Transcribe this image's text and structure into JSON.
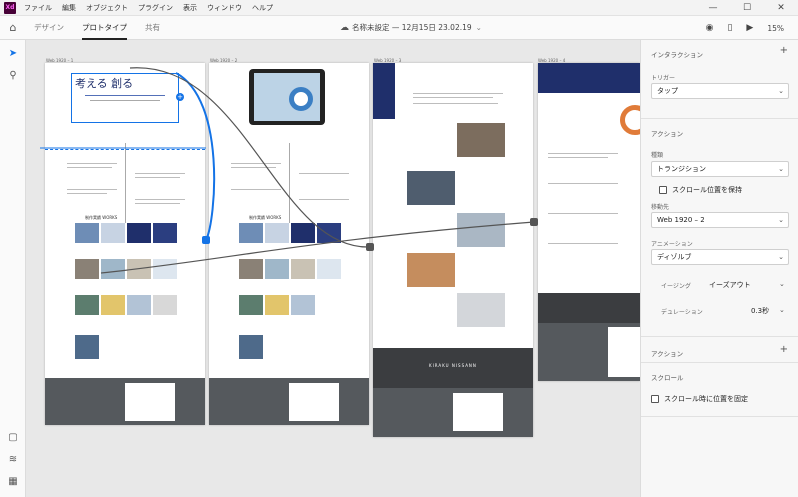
{
  "app": {
    "logo": "Xd",
    "menu": [
      "ファイル",
      "編集",
      "オブジェクト",
      "プラグイン",
      "表示",
      "ウィンドウ",
      "ヘルプ"
    ],
    "window_controls": [
      "—",
      "☐",
      "✕"
    ]
  },
  "toolbar": {
    "tabs": [
      "デザイン",
      "プロトタイプ",
      "共有"
    ],
    "active_tab": "プロトタイプ",
    "doc_title": "名称未設定 — 12月15日 23.02.19",
    "zoom": "15%"
  },
  "canvas": {
    "artboard_labels": [
      "Web 1920 – 1",
      "Web 1920 – 2",
      "Web 1920 – 3",
      "Web 1920 – 4"
    ],
    "hero_text": "考える 創る",
    "section_title": "制作実績  WORKS",
    "footer_brand": "KIRAKU NISSANN"
  },
  "panel": {
    "interaction_heading": "インタラクション",
    "trigger_label": "トリガー",
    "trigger_value": "タップ",
    "action_heading": "アクション",
    "type_label": "種類",
    "type_value": "トランジション",
    "preserve_scroll": "スクロール位置を保持",
    "destination_label": "移動先",
    "destination_value": "Web 1920 – 2",
    "animation_label": "アニメーション",
    "animation_value": "ディゾルブ",
    "easing_label": "イージング",
    "easing_value": "イーズアウト",
    "duration_label": "デュレーション",
    "duration_value": "0.3秒",
    "action_heading2": "アクション",
    "scroll_heading": "スクロール",
    "fix_on_scroll": "スクロール時に位置を固定"
  },
  "colors": {
    "accent": "#1473e6",
    "xd_brand": "#470137",
    "footer": "#55595d",
    "navy": "#1f2f6b"
  }
}
